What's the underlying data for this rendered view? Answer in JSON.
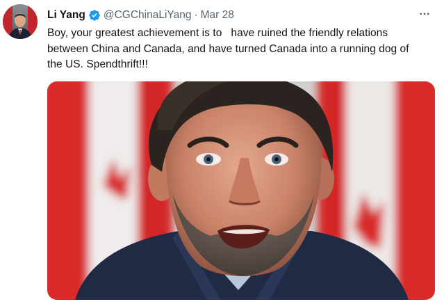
{
  "tweet": {
    "author": {
      "display_name": "Li Yang",
      "handle": "@CGChinaLiYang",
      "verified": true,
      "avatar_icon": "profile-photo"
    },
    "separator": "·",
    "date": "Mar 28",
    "more_icon": "more-horizontal-icon",
    "text_lines": [
      "Boy, your greatest achievement is to   have ruined the friendly relations",
      "between China and Canada, and have turned Canada into a running dog of",
      "the US. Spendthrift!!!"
    ],
    "media": {
      "type": "photo",
      "icon": "photo-of-man-speaking"
    }
  },
  "colors": {
    "verified_blue": "#1d9bf0",
    "secondary_text": "#536471",
    "primary_text": "#0f1419",
    "flag_red": "#d92a2a"
  }
}
